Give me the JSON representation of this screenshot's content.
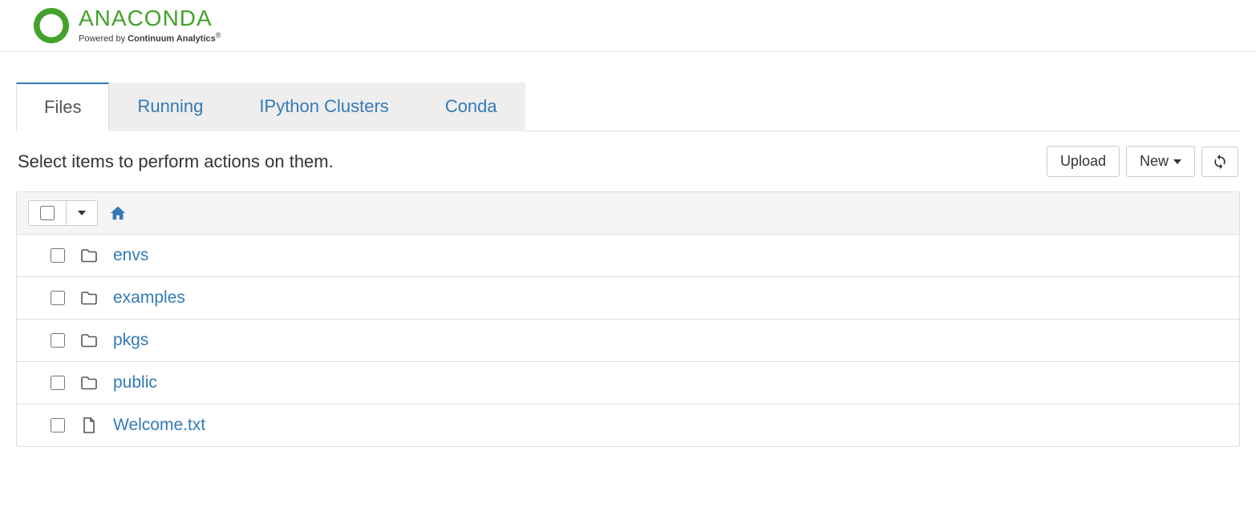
{
  "brand": {
    "name": "ANACONDA",
    "tagline_prefix": "Powered by ",
    "tagline_bold": "Continuum Analytics",
    "color": "#44a12b"
  },
  "tabs": [
    {
      "label": "Files",
      "active": true
    },
    {
      "label": "Running",
      "active": false
    },
    {
      "label": "IPython Clusters",
      "active": false
    },
    {
      "label": "Conda",
      "active": false
    }
  ],
  "toolbar": {
    "hint": "Select items to perform actions on them.",
    "upload_label": "Upload",
    "new_label": "New"
  },
  "listing": {
    "items": [
      {
        "type": "folder",
        "name": "envs"
      },
      {
        "type": "folder",
        "name": "examples"
      },
      {
        "type": "folder",
        "name": "pkgs"
      },
      {
        "type": "folder",
        "name": "public"
      },
      {
        "type": "file",
        "name": "Welcome.txt"
      }
    ]
  }
}
